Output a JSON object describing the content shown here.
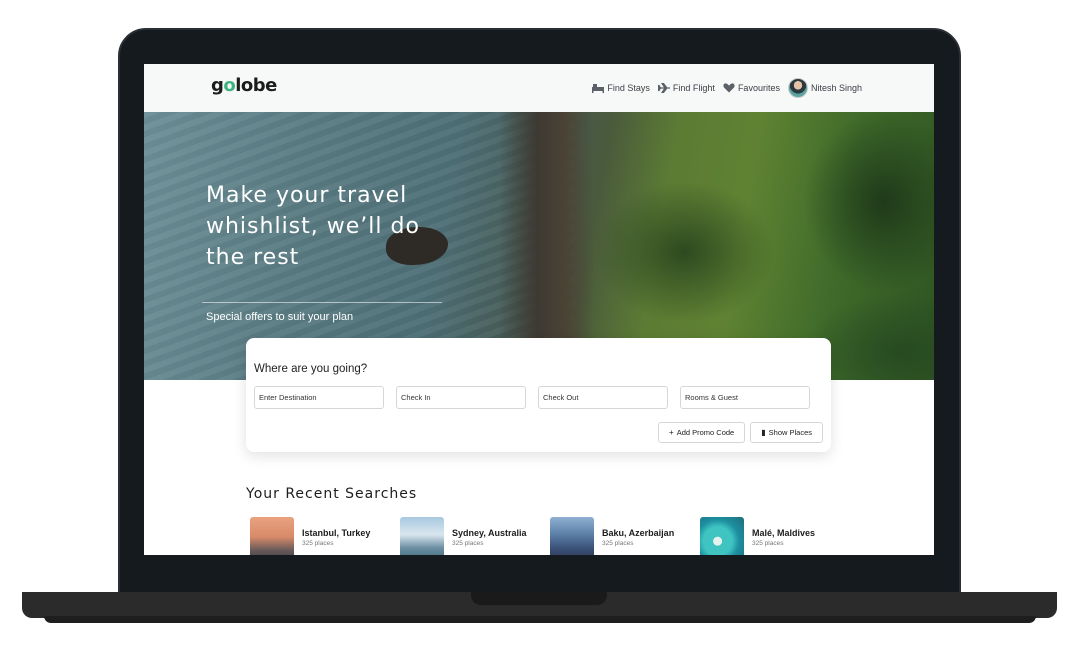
{
  "brand": {
    "logo_prefix": "g",
    "logo_o": "o",
    "logo_suffix": "lobe",
    "accent": "#3fb37f"
  },
  "nav": {
    "items": [
      {
        "label": "Find Stays",
        "icon": "bed-icon"
      },
      {
        "label": "Find Flight",
        "icon": "airplane-icon"
      },
      {
        "label": "Favourites",
        "icon": "heart-icon"
      }
    ],
    "user_name": "Nitesh Singh"
  },
  "hero": {
    "title": "Make your travel whishlist, we’ll do the rest",
    "subtitle": "Special offers to suit your plan"
  },
  "search": {
    "heading": "Where are you going?",
    "fields": {
      "destination": "Enter Destination",
      "check_in": "Check In",
      "check_out": "Check Out",
      "rooms": "Rooms & Guest"
    },
    "promo_label": "Add Promo Code",
    "show_label": "Show Places"
  },
  "recent": {
    "title": "Your Recent Searches",
    "items": [
      {
        "name": "Istanbul, Turkey",
        "count": "325 places"
      },
      {
        "name": "Sydney, Australia",
        "count": "325 places"
      },
      {
        "name": "Baku, Azerbaijan",
        "count": "325 places"
      },
      {
        "name": "Malé, Maldives",
        "count": "325 places"
      }
    ]
  }
}
